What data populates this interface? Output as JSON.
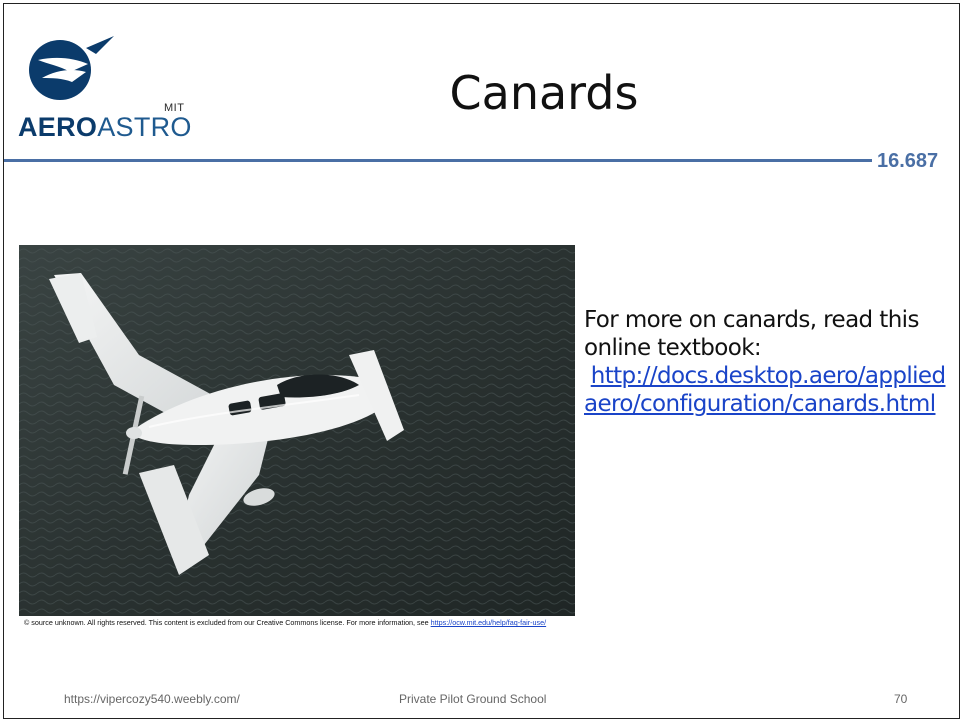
{
  "logo": {
    "mit": "MIT",
    "aero": "AERO",
    "astro": "ASTRO"
  },
  "title": "Canards",
  "course_number": "16.687",
  "photo_alt": "White canard aircraft in flight over water",
  "credit": {
    "text": "© source unknown. All rights reserved. This content is excluded from our Creative Commons license. For more information, see",
    "link": "https://ocw.mit.edu/help/faq-fair-use/"
  },
  "body": {
    "text": "For more on canards, read this online textbook:",
    "link": "http://docs.desktop.aero/appliedaero/configuration/canards.html"
  },
  "footer": {
    "left": "https://vipercozy540.weebly.com/",
    "center": "Private Pilot Ground School",
    "page": "70"
  },
  "colors": {
    "accent": "#4a6fa5",
    "logo_dark": "#0b3b6b",
    "link": "#1a44c8"
  }
}
